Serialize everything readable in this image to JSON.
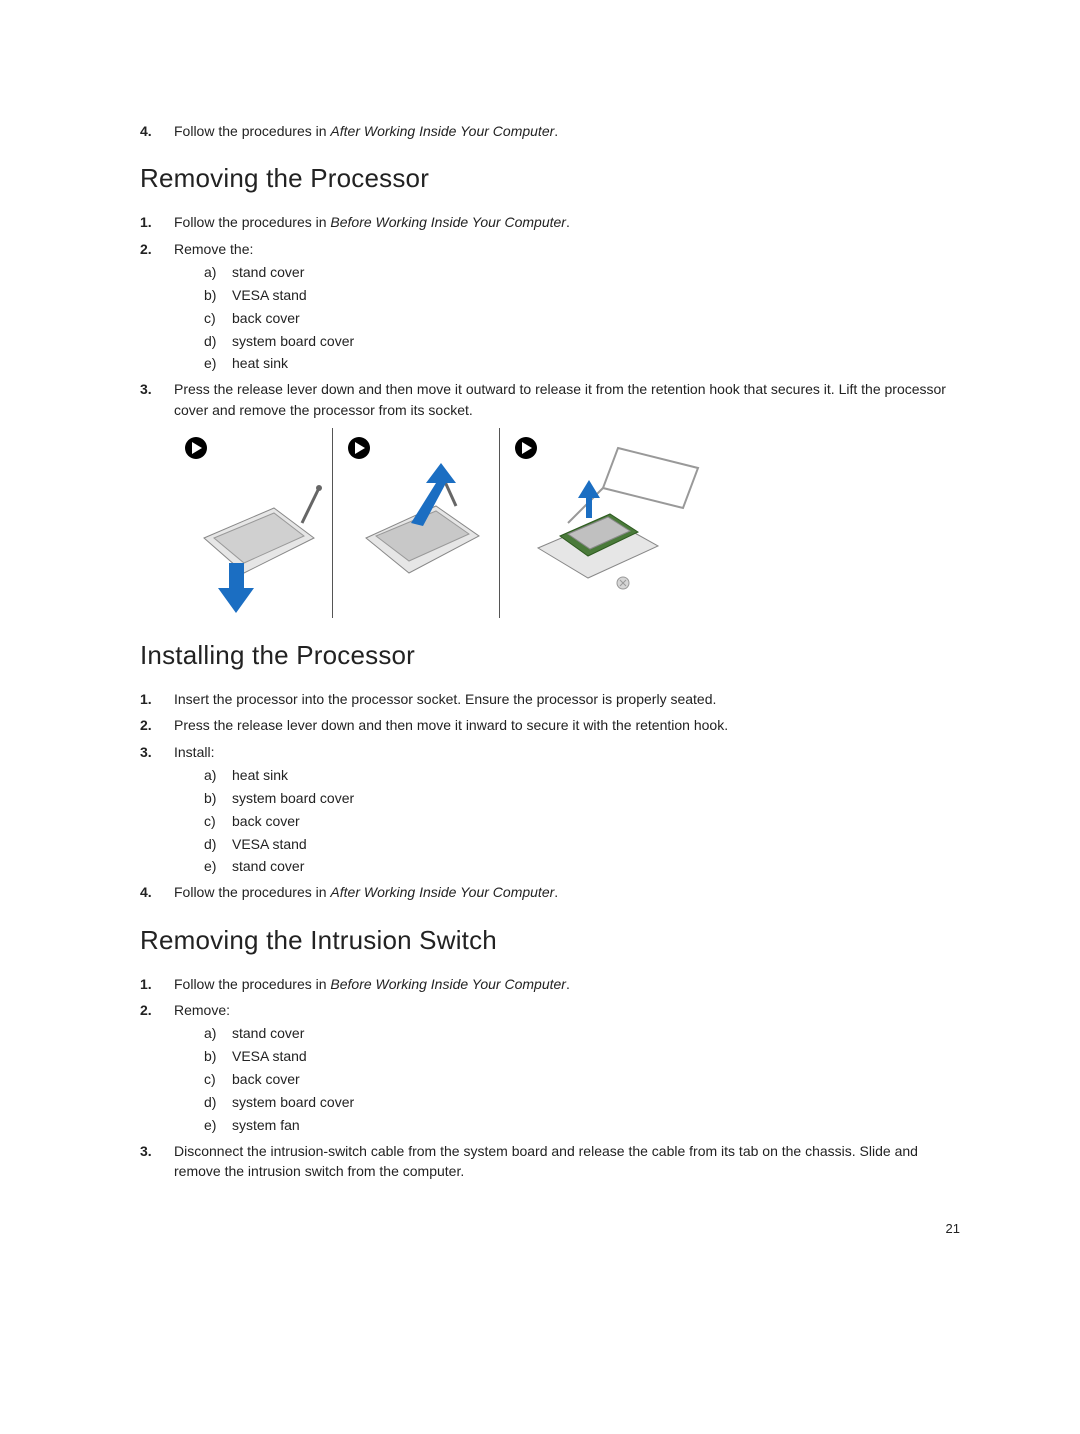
{
  "page_number": "21",
  "top_step": {
    "num": "4.",
    "text_before": "Follow the procedures in ",
    "text_italic": "After Working Inside Your Computer",
    "text_after": "."
  },
  "section1": {
    "heading": "Removing the Processor",
    "steps": [
      {
        "num": "1.",
        "text_before": "Follow the procedures in ",
        "text_italic": "Before Working Inside Your Computer",
        "text_after": "."
      },
      {
        "num": "2.",
        "text_before": "Remove the:",
        "sub": [
          {
            "m": "a)",
            "t": "stand cover"
          },
          {
            "m": "b)",
            "t": "VESA stand"
          },
          {
            "m": "c)",
            "t": "back cover"
          },
          {
            "m": "d)",
            "t": "system board cover"
          },
          {
            "m": "e)",
            "t": "heat sink"
          }
        ]
      },
      {
        "num": "3.",
        "text_before": "Press the release lever down and then move it outward to release it from the retention hook that secures it. Lift the processor cover and remove the processor from its socket."
      }
    ]
  },
  "section2": {
    "heading": "Installing the Processor",
    "steps": [
      {
        "num": "1.",
        "text_before": "Insert the processor into the processor socket. Ensure the processor is properly seated."
      },
      {
        "num": "2.",
        "text_before": "Press the release lever down and then move it inward to secure it with the retention hook."
      },
      {
        "num": "3.",
        "text_before": "Install:",
        "sub": [
          {
            "m": "a)",
            "t": "heat sink"
          },
          {
            "m": "b)",
            "t": "system board cover"
          },
          {
            "m": "c)",
            "t": "back cover"
          },
          {
            "m": "d)",
            "t": "VESA stand"
          },
          {
            "m": "e)",
            "t": "stand cover"
          }
        ]
      },
      {
        "num": "4.",
        "text_before": "Follow the procedures in ",
        "text_italic": "After Working Inside Your Computer",
        "text_after": "."
      }
    ]
  },
  "section3": {
    "heading": "Removing the Intrusion Switch",
    "steps": [
      {
        "num": "1.",
        "text_before": "Follow the procedures in ",
        "text_italic": "Before Working Inside Your Computer",
        "text_after": "."
      },
      {
        "num": "2.",
        "text_before": "Remove:",
        "sub": [
          {
            "m": "a)",
            "t": "stand cover"
          },
          {
            "m": "b)",
            "t": "VESA stand"
          },
          {
            "m": "c)",
            "t": "back cover"
          },
          {
            "m": "d)",
            "t": "system board cover"
          },
          {
            "m": "e)",
            "t": "system fan"
          }
        ]
      },
      {
        "num": "3.",
        "text_before": "Disconnect the intrusion-switch cable from the system board and release the cable from its tab on the chassis. Slide and remove the intrusion switch from the computer."
      }
    ]
  }
}
